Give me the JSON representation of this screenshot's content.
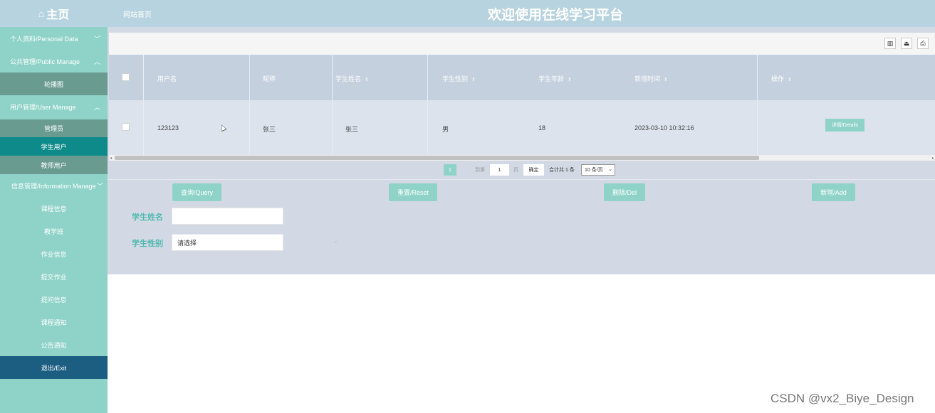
{
  "header": {
    "home_label": "主页",
    "site_link": "网站首页",
    "app_title": "欢迎使用在线学习平台"
  },
  "sidebar": {
    "personal": "个人资料/Personal Data",
    "public_manage": "公共管理/Public Manage",
    "carousel": "轮播图",
    "user_manage": "用户管理/User Manage",
    "admin": "管理员",
    "student_user": "学生用户",
    "teacher_user": "教师用户",
    "info_manage": "信息管理/Information Manage",
    "items": [
      "课程信息",
      "教学班",
      "作业信息",
      "提交作业",
      "提问信息",
      "课程通知",
      "公告通知"
    ],
    "exit": "退出/Exit"
  },
  "table": {
    "headers": [
      "用户名",
      "昵称",
      "学生姓名",
      "学生性别",
      "学生年龄",
      "新增时间",
      "操作"
    ],
    "row": {
      "username": "123123",
      "nickname": "张三",
      "name": "张三",
      "gender": "男",
      "age": "18",
      "created": "2023-03-10 10:32:16",
      "details": "详情/Details"
    }
  },
  "pagination": {
    "current_page": "1",
    "goto_label": "到第",
    "goto_value": "1",
    "page_unit": "页",
    "confirm": "确定",
    "total": "合计共 1 条",
    "page_size": "10 条/页"
  },
  "actions": {
    "query": "查询/Query",
    "reset": "重置/Reset",
    "delete": "删除/Del",
    "add": "新增/Add"
  },
  "form": {
    "name_label": "学生姓名",
    "name_value": "",
    "gender_label": "学生性别",
    "gender_placeholder": "请选择"
  },
  "watermark": "CSDN @vx2_Biye_Design",
  "colors": {
    "sidebar": "#8fd3c8",
    "header": "#b6d3df",
    "active": "#0e8a8a",
    "exit": "#1c5e82",
    "main": "#d2d9e4"
  }
}
